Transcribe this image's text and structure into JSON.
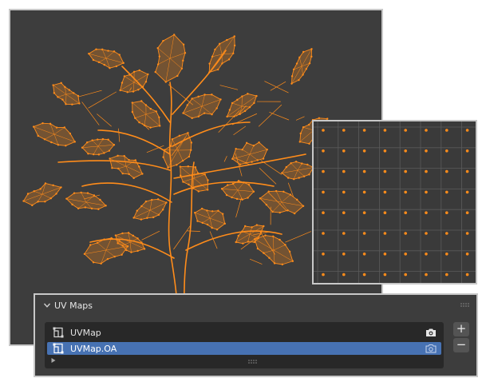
{
  "panel": {
    "title": "UV Maps",
    "items": [
      {
        "label": "UVMap",
        "active": false,
        "render_icon": "camera-icon"
      },
      {
        "label": "UVMap.OA",
        "active": true,
        "render_icon": "camera-outline-icon"
      }
    ],
    "add_label": "+",
    "remove_label": "−"
  },
  "colors": {
    "accent_orange": "#ff8c1a",
    "selection_blue": "#4772b3",
    "viewport_bg": "#3d3d3d",
    "frame_border": "#c8c8c8"
  },
  "uv_grid": {
    "columns": 8,
    "rows": 8
  }
}
